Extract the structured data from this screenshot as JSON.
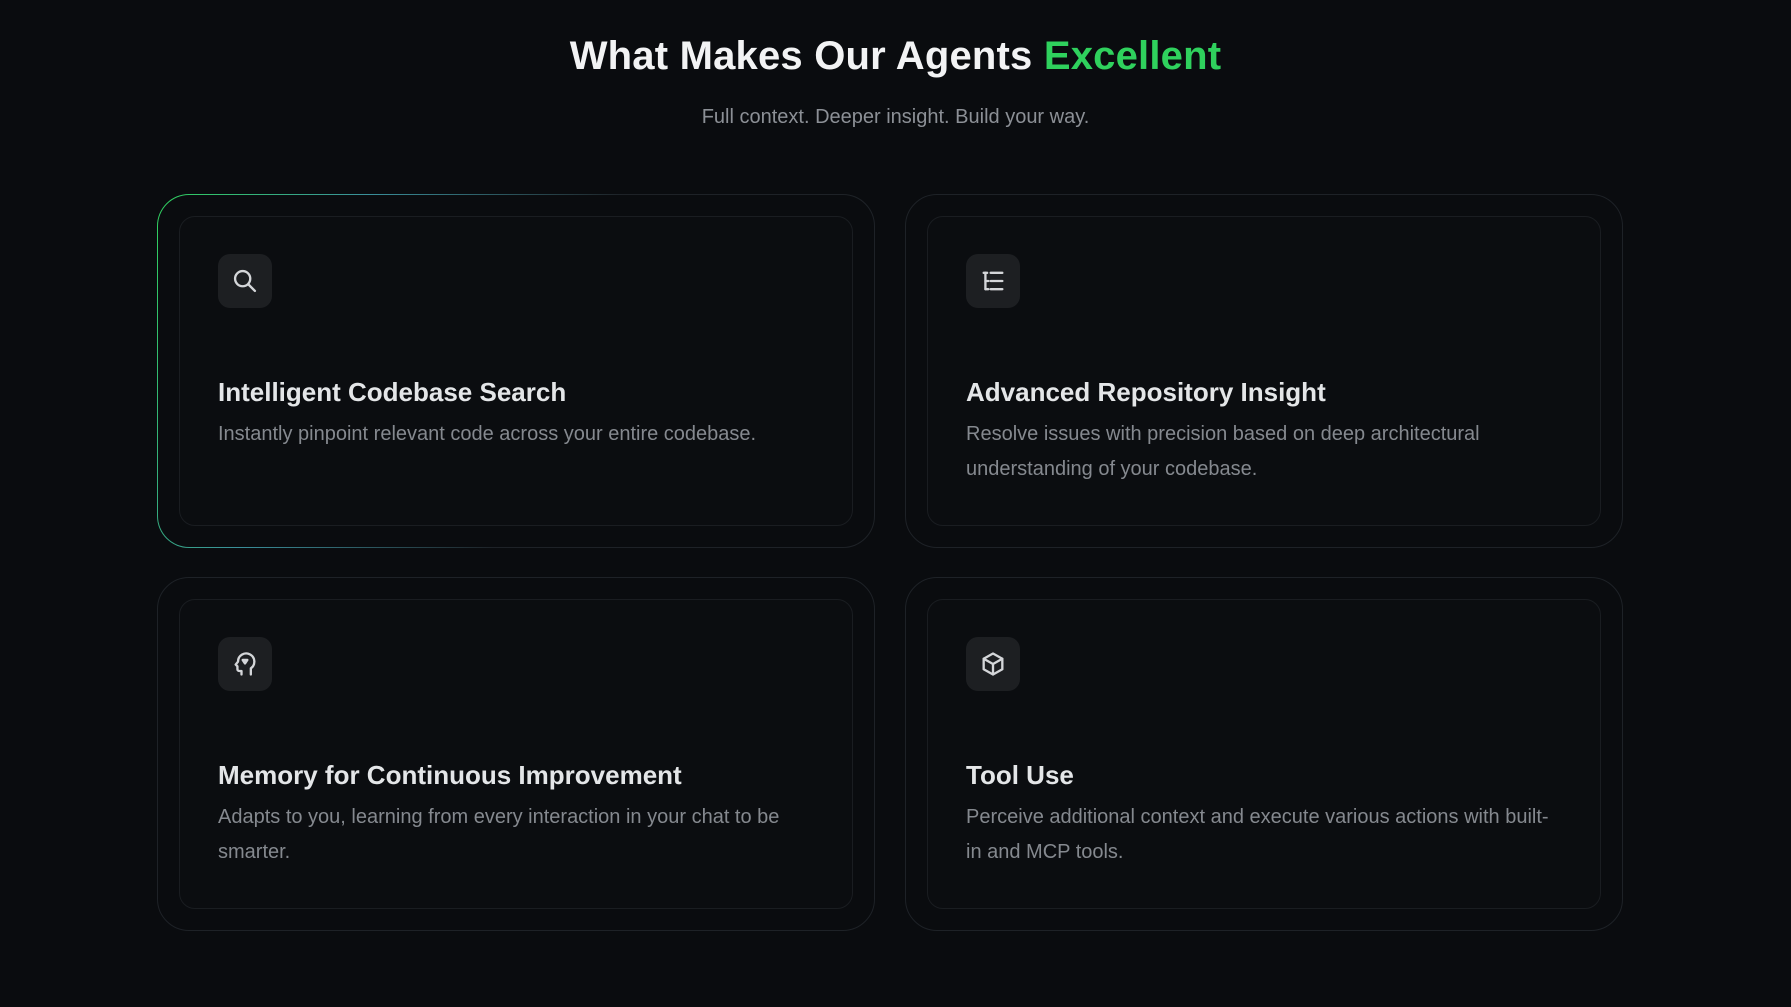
{
  "header": {
    "title_main": "What Makes Our Agents",
    "title_accent": "Excellent",
    "subtitle": "Full context. Deeper insight. Build your way."
  },
  "colors": {
    "accent": "#2fd15d",
    "background": "#0a0c0f"
  },
  "features": [
    {
      "icon": "search-icon",
      "title": "Intelligent Codebase Search",
      "description": "Instantly pinpoint relevant code across your entire codebase."
    },
    {
      "icon": "list-tree-icon",
      "title": "Advanced Repository Insight",
      "description": "Resolve issues with precision based on deep architectural understanding of your codebase."
    },
    {
      "icon": "head-brain-icon",
      "title": "Memory for Continuous Improvement",
      "description": "Adapts to you, learning from every interaction in your chat to be smarter."
    },
    {
      "icon": "box-icon",
      "title": "Tool Use",
      "description": "Perceive additional context and execute various actions with built-in and MCP tools."
    }
  ]
}
